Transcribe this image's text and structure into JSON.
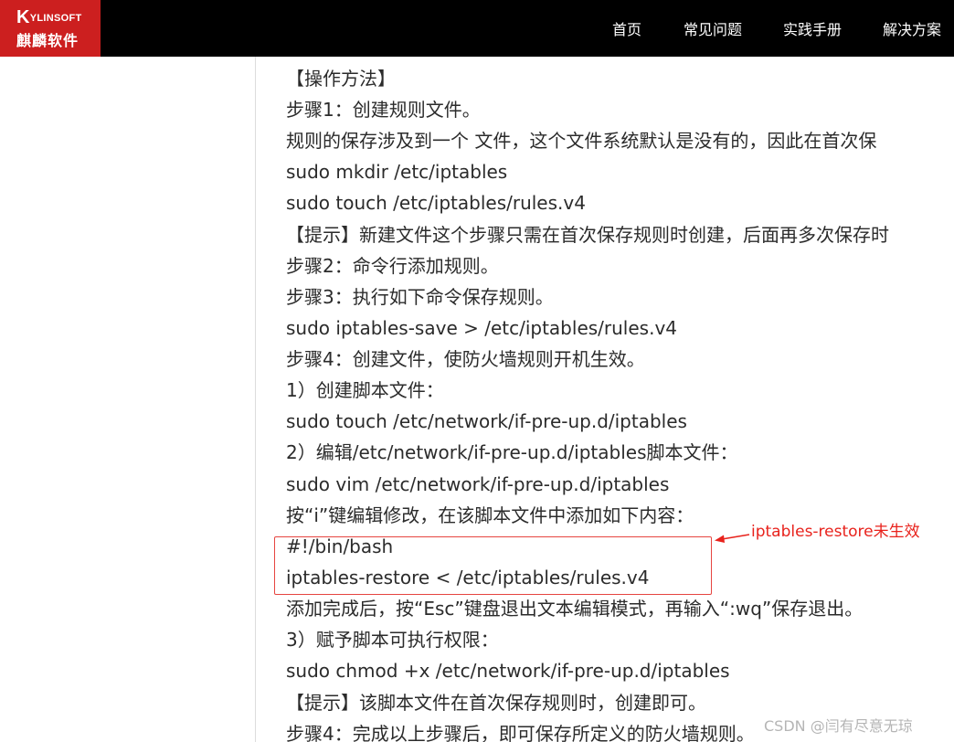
{
  "header": {
    "logo": {
      "top": "YLINSOFT",
      "mark": "K",
      "cn": "麒麟软件"
    },
    "nav": [
      {
        "label": "首页"
      },
      {
        "label": "常见问题"
      },
      {
        "label": "实践手册"
      },
      {
        "label": "解决方案"
      }
    ]
  },
  "article": {
    "lines": [
      "【操作方法】",
      "步骤1：创建规则文件。",
      "规则的保存涉及到一个 文件，这个文件系统默认是没有的，因此在首次保",
      "sudo mkdir /etc/iptables",
      "sudo touch /etc/iptables/rules.v4",
      "【提示】新建文件这个步骤只需在首次保存规则时创建，后面再多次保存时",
      "步骤2：命令行添加规则。",
      "步骤3：执行如下命令保存规则。",
      "sudo iptables-save > /etc/iptables/rules.v4",
      "步骤4：创建文件，使防火墙规则开机生效。",
      "1）创建脚本文件：",
      "sudo touch /etc/network/if-pre-up.d/iptables",
      "2）编辑/etc/network/if-pre-up.d/iptables脚本文件：",
      "sudo vim /etc/network/if-pre-up.d/iptables",
      "按“i”键编辑修改，在该脚本文件中添加如下内容：",
      "#!/bin/bash",
      "iptables-restore < /etc/iptables/rules.v4",
      "添加完成后，按“Esc”键盘退出文本编辑模式，再输入“:wq”保存退出。",
      "3）赋予脚本可执行权限：",
      "sudo chmod +x /etc/network/if-pre-up.d/iptables",
      "【提示】该脚本文件在首次保存规则时，创建即可。",
      "步骤4：完成以上步骤后，即可保存所定义的防火墙规则。"
    ]
  },
  "annotation": {
    "text": "iptables-restore未生效",
    "color": "#e8221c"
  },
  "watermark": "CSDN @闫有尽意无琼"
}
